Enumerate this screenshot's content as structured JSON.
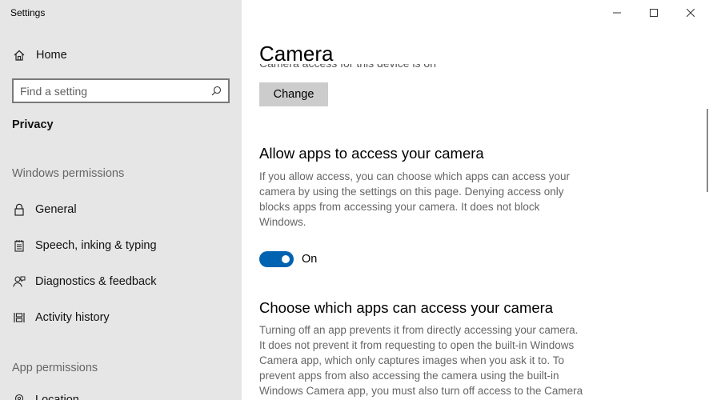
{
  "window": {
    "title": "Settings"
  },
  "sidebar": {
    "home_label": "Home",
    "search_placeholder": "Find a setting",
    "section_title": "Privacy",
    "windows_permissions_label": "Windows permissions",
    "items": [
      {
        "label": "General",
        "icon": "lock-icon"
      },
      {
        "label": "Speech, inking & typing",
        "icon": "notepad-icon"
      },
      {
        "label": "Diagnostics & feedback",
        "icon": "person-feedback-icon"
      },
      {
        "label": "Activity history",
        "icon": "timeline-icon"
      }
    ],
    "app_permissions_label": "App permissions",
    "partial_item_label": "Location"
  },
  "main": {
    "title": "Camera",
    "cut_status_text": "Camera access for this device is on",
    "change_button": "Change",
    "allow_heading": "Allow apps to access your camera",
    "allow_paragraph": [
      "If you allow access, you can choose which apps can access your",
      "camera by using the settings on this page. Denying access only",
      "blocks apps from accessing your camera. It does not block",
      "Windows."
    ],
    "toggle_state": "On",
    "choose_heading": "Choose which apps can access your camera",
    "choose_paragraph": [
      "Turning off an app prevents it from directly accessing your camera.",
      "It does not prevent it from requesting to open the built-in Windows",
      "Camera app, which only captures images when you ask it to. To",
      "prevent apps from also accessing the camera using the built-in",
      "Windows Camera app, you must also turn off access to the Camera"
    ]
  },
  "colors": {
    "accent": "#0063b1",
    "sidebar_bg": "#e6e6e6",
    "button_bg": "#cccccc"
  }
}
